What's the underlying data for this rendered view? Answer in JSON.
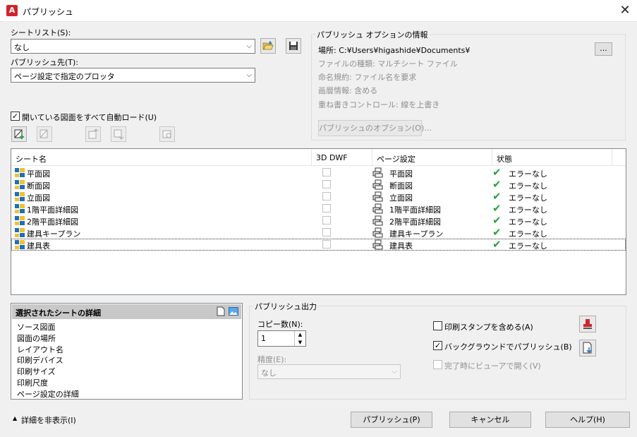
{
  "window": {
    "app_icon": "A",
    "title": "パブリッシュ",
    "close": "✕"
  },
  "sheet_list": {
    "label": "シートリスト(S):",
    "value": "なし"
  },
  "publish_to": {
    "label": "パブリッシュ先(T):",
    "value": "ページ設定で指定のプロッタ"
  },
  "autoload": {
    "label": "開いている図面をすべて自動ロード(U)",
    "checked": true
  },
  "options_info": {
    "title": "パブリッシュ オプションの情報",
    "location": "場所: C:¥Users¥higashide¥Documents¥",
    "browse_button": "...",
    "file_type": "ファイルの種類: マルチシート ファイル",
    "naming": "命名規約: ファイル名を要求",
    "layer_info": "画層情報: 含める",
    "merge_control": "重ね書きコントロール: 線を上書き",
    "options_button": "パブリッシュのオプション(O)..."
  },
  "columns": {
    "sheet_name": "シート名",
    "dwf3d": "3D DWF",
    "page_setup": "ページ設定",
    "status": "状態"
  },
  "sheets": [
    {
      "name": "平面図",
      "page_setup": "平面図",
      "status": "エラーなし"
    },
    {
      "name": "断面図",
      "page_setup": "断面図",
      "status": "エラーなし"
    },
    {
      "name": "立面図",
      "page_setup": "立面図",
      "status": "エラーなし"
    },
    {
      "name": "1階平面詳細図",
      "page_setup": "1階平面詳細図",
      "status": "エラーなし"
    },
    {
      "name": "2階平面詳細図",
      "page_setup": "2階平面詳細図",
      "status": "エラーなし"
    },
    {
      "name": "建具キープラン",
      "page_setup": "建具キープラン",
      "status": "エラーなし"
    },
    {
      "name": "建具表",
      "page_setup": "建具表",
      "status": "エラーなし"
    }
  ],
  "details": {
    "title": "選択されたシートの詳細",
    "items": [
      "ソース図面",
      "図面の場所",
      "レイアウト名",
      "印刷デバイス",
      "印刷サイズ",
      "印刷尺度",
      "ページ設定の詳細"
    ]
  },
  "output": {
    "title": "パブリッシュ出力",
    "copies_label": "コピー数(N):",
    "copies_value": "1",
    "precision_label": "精度(E):",
    "precision_value": "なし",
    "stamp_label": "印刷スタンプを含める(A)",
    "stamp_checked": false,
    "background_label": "バックグラウンドでパブリッシュ(B)",
    "background_checked": true,
    "viewer_label": "完了時にビューアで開く(V)",
    "viewer_checked": false
  },
  "footer": {
    "hide_details": "詳細を非表示(I)",
    "publish": "パブリッシュ(P)",
    "cancel": "キャンセル",
    "help": "ヘルプ(H)"
  },
  "colors": {
    "accent_icon": "#1d6fb8",
    "ok_green": "#2ea043",
    "app_red": "#d0252b"
  }
}
